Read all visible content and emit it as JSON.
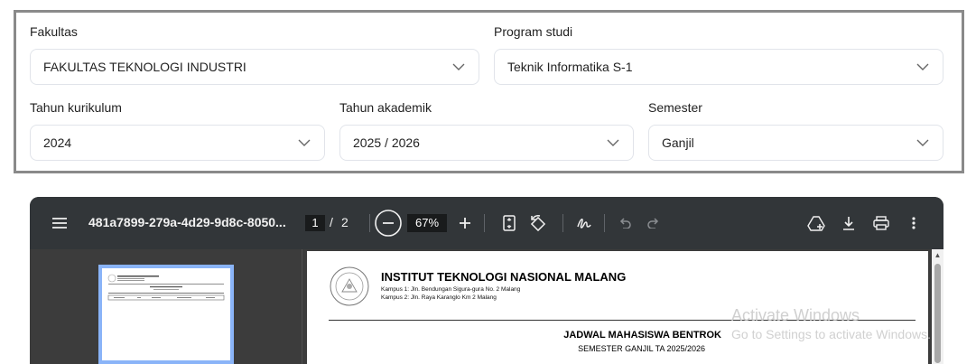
{
  "filters": {
    "fakultas": {
      "label": "Fakultas",
      "value": "FAKULTAS TEKNOLOGI INDUSTRI"
    },
    "program_studi": {
      "label": "Program studi",
      "value": "Teknik Informatika S-1"
    },
    "tahun_kurikulum": {
      "label": "Tahun kurikulum",
      "value": "2024"
    },
    "tahun_akademik": {
      "label": "Tahun akademik",
      "value": "2025 / 2026"
    },
    "semester": {
      "label": "Semester",
      "value": "Ganjil"
    }
  },
  "pdf_viewer": {
    "title": "481a7899-279a-4d29-9d8c-8050...",
    "current_page": "1",
    "page_separator": "/",
    "total_pages": "2",
    "zoom": "67%",
    "icons": [
      "menu-icon",
      "zoom-out-icon",
      "zoom-in-icon",
      "fit-page-icon",
      "rotate-icon",
      "annotate-icon",
      "undo-icon",
      "redo-icon",
      "save-to-drive-icon",
      "download-icon",
      "print-icon",
      "more-options-icon"
    ],
    "colors": {
      "toolbar": "#323639",
      "background": "#3c3c3c",
      "thumbnail_highlight": "#8ab4f8"
    }
  },
  "document": {
    "institution": "INSTITUT TEKNOLOGI NASIONAL MALANG",
    "address_1": "Kampus 1: Jln. Bendungan Sigura-gura No. 2 Malang",
    "address_2": "Kampus 2: Jln. Raya Karanglo Km 2 Malang",
    "heading": "JADWAL MAHASISWA BENTROK",
    "subheading": "SEMESTER GANJIL TA 2025/2026"
  },
  "watermark": {
    "line1": "Activate Windows",
    "line2": "Go to Settings to activate Windows."
  }
}
